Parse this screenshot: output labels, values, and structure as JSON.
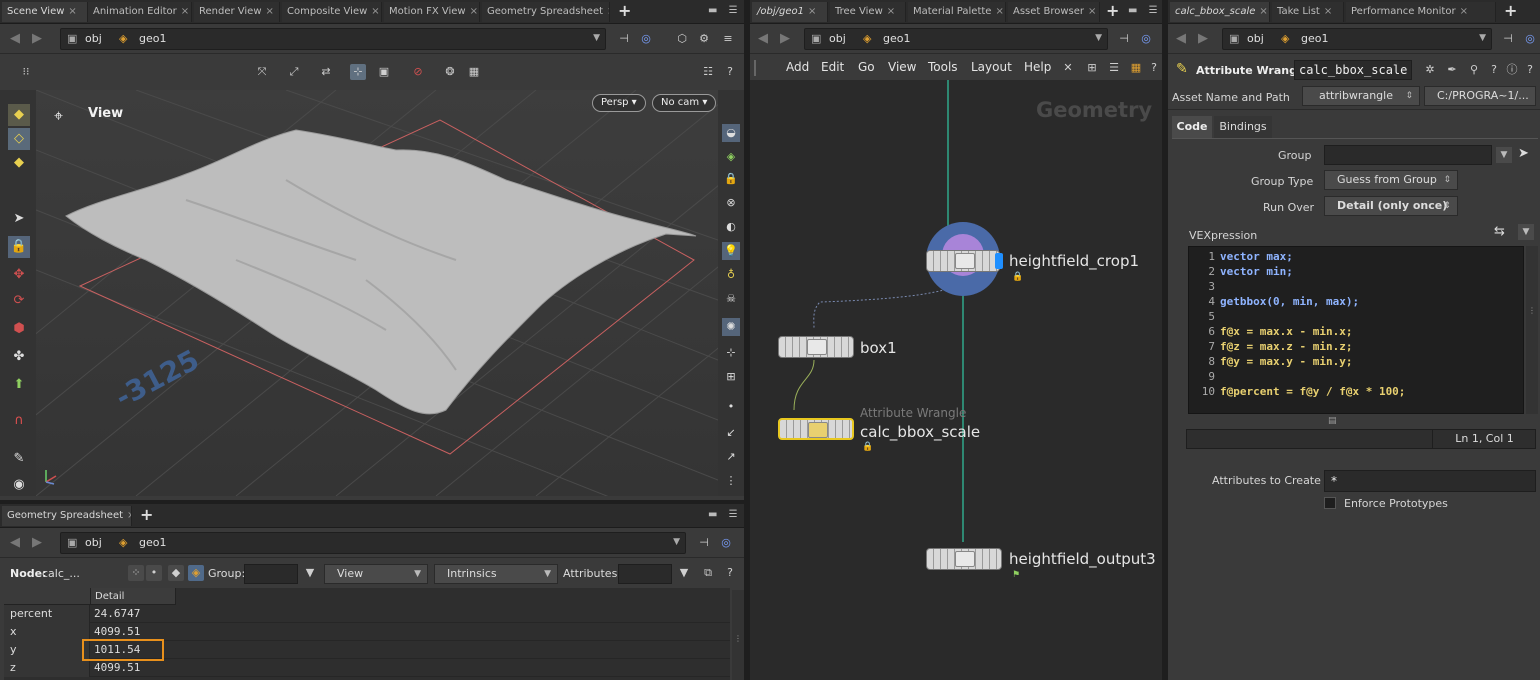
{
  "left_panel": {
    "tabs": [
      "Scene View",
      "Animation Editor",
      "Render View",
      "Composite View",
      "Motion FX View",
      "Geometry Spreadsheet"
    ],
    "path": {
      "obj": "obj",
      "geo": "geo1"
    },
    "viewport": {
      "label": "View",
      "persp": "Persp",
      "cam": "No cam",
      "grid_number": "-3125"
    }
  },
  "spreadsheet": {
    "tab": "Geometry Spreadsheet",
    "path": {
      "obj": "obj",
      "geo": "geo1"
    },
    "node_label": "Node:",
    "node_value": "calc_...",
    "group_label": "Group:",
    "view_label": "View",
    "intrinsics_label": "Intrinsics",
    "attributes_label": "Attributes:",
    "column_header": "Detail",
    "rows": [
      {
        "name": "percent",
        "value": "24.6747"
      },
      {
        "name": "x",
        "value": "4099.51"
      },
      {
        "name": "y",
        "value": "1011.54"
      },
      {
        "name": "z",
        "value": "4099.51"
      }
    ],
    "highlight_color": "#e8901c"
  },
  "network": {
    "tabs": [
      "/obj/geo1",
      "Tree View",
      "Material Palette",
      "Asset Browser"
    ],
    "path": {
      "obj": "obj",
      "geo": "geo1"
    },
    "menu": [
      "Add",
      "Edit",
      "Go",
      "View",
      "Tools",
      "Layout",
      "Help"
    ],
    "watermark": "Geometry",
    "nodes": {
      "heightfield_crop": "heightfield_crop1",
      "box": "box1",
      "wrangle_type": "Attribute Wrangle",
      "wrangle": "calc_bbox_scale",
      "output": "heightfield_output3"
    }
  },
  "params": {
    "tabs": [
      "calc_bbox_scale",
      "Take List",
      "Performance Monitor"
    ],
    "path": {
      "obj": "obj",
      "geo": "geo1"
    },
    "node_type": "Attribute Wrangle",
    "node_name": "calc_bbox_scale",
    "asset_label": "Asset Name and Path",
    "asset_name": "attribwrangle",
    "asset_path": "C:/PROGRA~1/...",
    "subtabs": [
      "Code",
      "Bindings"
    ],
    "group_label": "Group",
    "group_type_label": "Group Type",
    "group_type_value": "Guess from Group",
    "run_over_label": "Run Over",
    "run_over_value": "Detail (only once)",
    "vex_label": "VEXpression",
    "code": [
      {
        "n": "1",
        "text": "vector max;"
      },
      {
        "n": "2",
        "text": "vector min;"
      },
      {
        "n": "3",
        "text": ""
      },
      {
        "n": "4",
        "text": "getbbox(0, min, max);"
      },
      {
        "n": "5",
        "text": ""
      },
      {
        "n": "6",
        "text": "f@x = max.x - min.x;"
      },
      {
        "n": "7",
        "text": "f@z = max.z - min.z;"
      },
      {
        "n": "8",
        "text": "f@y = max.y - min.y;"
      },
      {
        "n": "9",
        "text": ""
      },
      {
        "n": "10",
        "text": "f@percent = f@y / f@x * 100;"
      }
    ],
    "cursor_pos": "Ln 1, Col 1",
    "attrs_label": "Attributes to Create",
    "attrs_value": "*",
    "enforce_label": "Enforce Prototypes"
  }
}
